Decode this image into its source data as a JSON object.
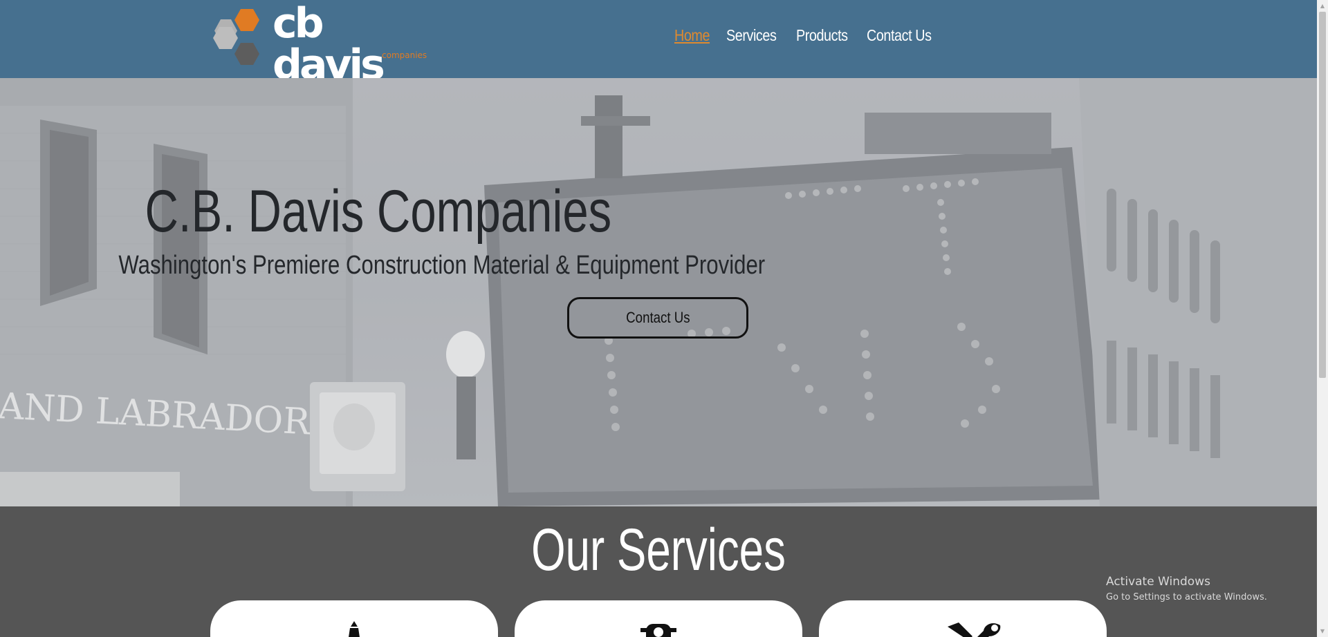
{
  "header": {
    "logo": {
      "wordmark": "cb davis",
      "tagline": "companies"
    },
    "nav": {
      "items": [
        {
          "label": "Home",
          "active": true
        },
        {
          "label": "Services",
          "active": false
        },
        {
          "label": "Products",
          "active": false
        },
        {
          "label": "Contact Us",
          "active": false
        }
      ]
    }
  },
  "hero": {
    "title": "C.B. Davis Companies",
    "subtitle": "Washington's Premiere Construction Material & Equipment Provider",
    "button_label": "Contact Us",
    "background_sign_text": "AND LABRADOR"
  },
  "services": {
    "title": "Our Services",
    "cards": [
      {
        "icon": "traffic-cone-icon"
      },
      {
        "icon": "traffic-light-icon"
      },
      {
        "icon": "wrench-tools-icon"
      }
    ]
  },
  "watermark": {
    "title": "Activate Windows",
    "subtitle": "Go to Settings to activate Windows."
  },
  "colors": {
    "header_bg": "#46708f",
    "accent": "#e08a2e",
    "services_bg": "#555555",
    "text_dark": "#24272b"
  }
}
